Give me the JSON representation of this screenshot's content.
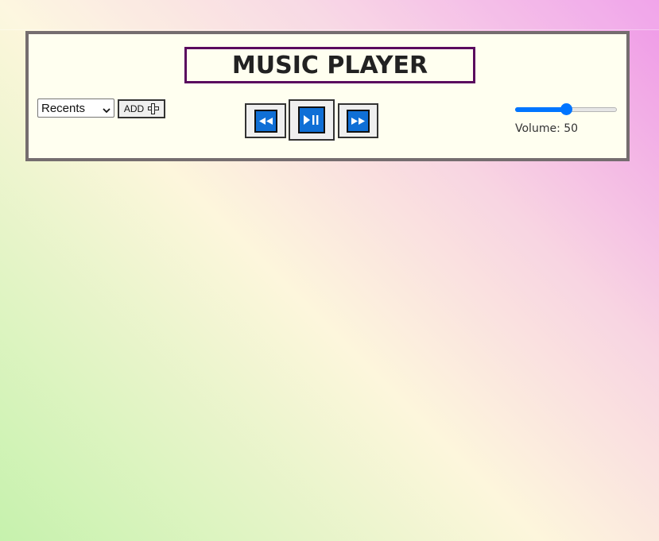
{
  "player": {
    "title": "MUSIC PLAYER",
    "playlist": {
      "selected": "Recents",
      "icon": "chevron-down-icon"
    },
    "add": {
      "label": "ADD",
      "icon": "plus-icon"
    },
    "controls": {
      "prev_icon": "rewind-icon",
      "play_icon": "play-pause-icon",
      "next_icon": "fast-forward-icon"
    },
    "volume": {
      "value": 50,
      "min": 0,
      "max": 100,
      "label": "Volume: 50"
    }
  },
  "colors": {
    "accent": "#0075ff",
    "button_face": "#0f6fd6",
    "title_border": "#5a0a5e",
    "panel_bg": "#fffff0",
    "panel_border": "#756d6f"
  }
}
